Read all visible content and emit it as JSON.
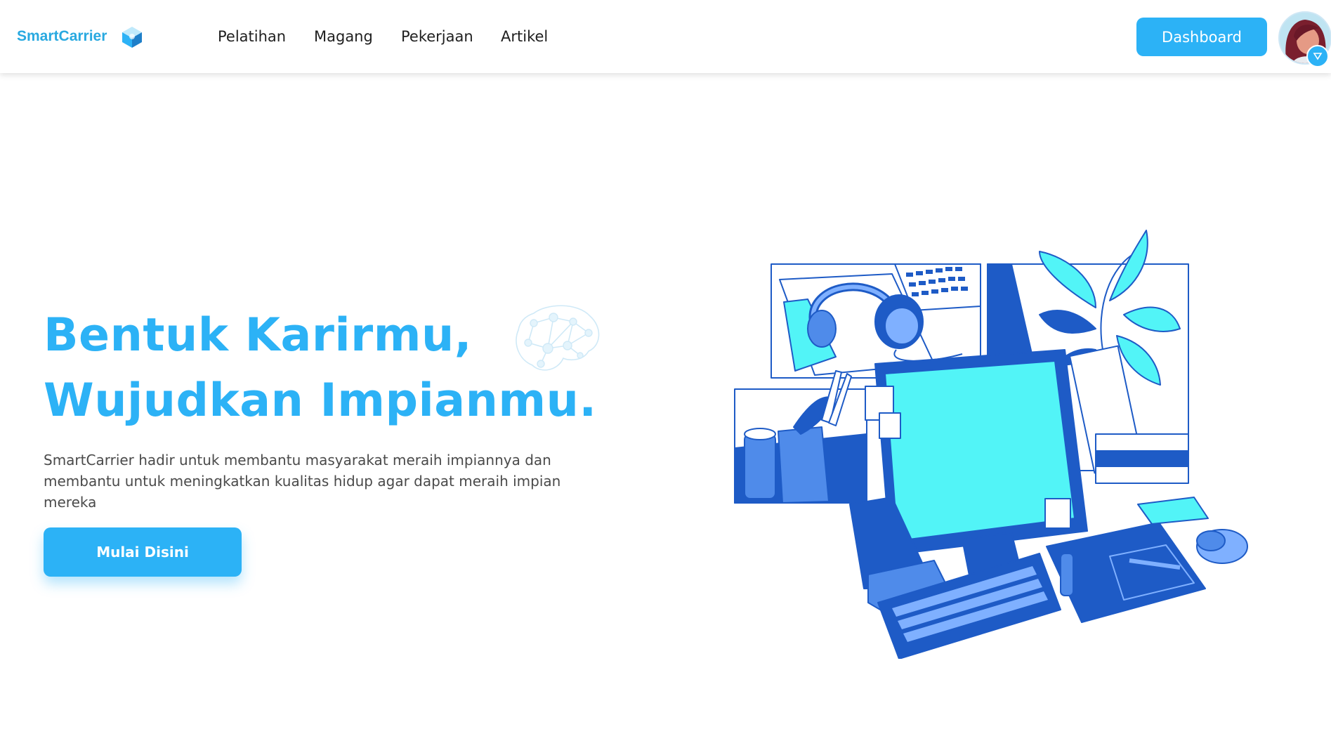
{
  "brand": {
    "name": "SmartCarrier",
    "logo_icon": "cube-logo-icon"
  },
  "nav": {
    "links": [
      "Pelatihan",
      "Magang",
      "Pekerjaan",
      "Artikel"
    ],
    "dashboard_label": "Dashboard",
    "avatar_icon": "user-avatar",
    "dropdown_icon": "chevron-down-icon"
  },
  "hero": {
    "title_line1": "Bentuk Karirmu,",
    "title_line2": "Wujudkan Impianmu.",
    "description": "SmartCarrier hadir untuk membantu masyarakat meraih impiannya dan membantu untuk meningkatkan kualitas hidup agar dapat meraih impian mereka",
    "cta_label": "Mulai Disini"
  },
  "colors": {
    "primary": "#2cb2f6",
    "dark_blue": "#1e5bc6",
    "cyan": "#52f4f7",
    "text": "#1f1f1f"
  }
}
